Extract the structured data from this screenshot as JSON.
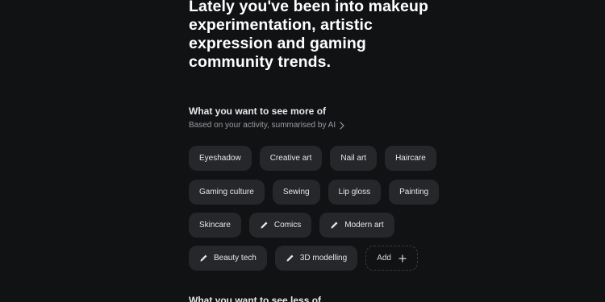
{
  "hero": {
    "title": "Lately you've been into makeup experimentation, artistic expression and gaming community trends."
  },
  "more_section": {
    "title": "What you want to see more of",
    "subtitle": "Based on your activity, summarised by AI",
    "chips_row1": [
      {
        "label": "Eyeshadow",
        "icon": ""
      },
      {
        "label": "Creative art",
        "icon": ""
      },
      {
        "label": "Nail art",
        "icon": ""
      },
      {
        "label": "Haircare",
        "icon": ""
      }
    ],
    "chips_row2": [
      {
        "label": "Gaming culture",
        "icon": ""
      },
      {
        "label": "Sewing",
        "icon": ""
      },
      {
        "label": "Lip gloss",
        "icon": ""
      },
      {
        "label": "Painting",
        "icon": ""
      }
    ],
    "chips_row3": [
      {
        "label": "Skincare",
        "icon": ""
      },
      {
        "label": "Comics",
        "icon": "pencil-icon"
      },
      {
        "label": "Modern art",
        "icon": "pencil-icon"
      }
    ],
    "chips_row4": [
      {
        "label": "Beauty tech",
        "icon": "pencil-icon"
      },
      {
        "label": "3D modelling",
        "icon": "pencil-icon"
      }
    ],
    "add_label": "Add"
  },
  "less_section": {
    "title": "What you want to see less of"
  },
  "colors": {
    "background": "#111214",
    "chip": "#26272a",
    "text_primary": "#ffffff",
    "text_secondary": "#9a9ca3"
  }
}
